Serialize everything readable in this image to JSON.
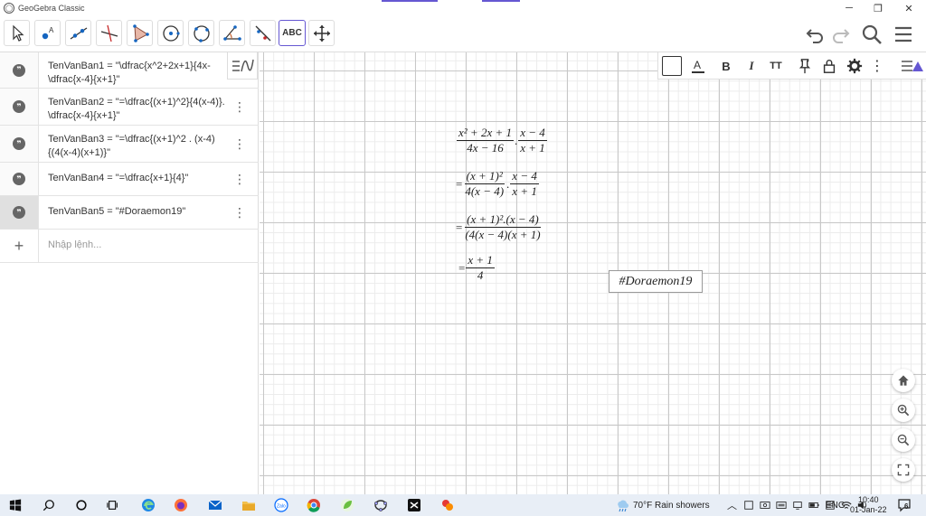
{
  "window": {
    "title": "GeoGebra Classic",
    "minimize": "─",
    "restore": "❐",
    "close": "✕"
  },
  "toolbar": {
    "tools": [
      "move",
      "point",
      "line",
      "perpendicular-line",
      "polygon",
      "circle-center",
      "circle-three-points",
      "angle",
      "reflect",
      "text",
      "move-graphics-view"
    ],
    "text_tool_label": "ABC"
  },
  "algebra": {
    "rows": [
      {
        "line1": "TenVanBan1 = \"\\dfrac{x^2+2x+1}{4x-",
        "line2": "\\dfrac{x-4}{x+1}\""
      },
      {
        "line1": "TenVanBan2 = \"=\\dfrac{(x+1)^2}{4(x-4)}.",
        "line2": "\\dfrac{x-4}{x+1}\""
      },
      {
        "line1": "TenVanBan3 = \"=\\dfrac{(x+1)^2 . (x-4)",
        "line2": "{(4(x-4)(x+1)}\""
      },
      {
        "line1": "TenVanBan4 = \"=\\dfrac{x+1}{4}\"",
        "line2": ""
      },
      {
        "line1": "TenVanBan5 = \"#Doraemon19\"",
        "line2": ""
      }
    ],
    "input_placeholder": "Nhập lệnh..."
  },
  "style_bar": {
    "bold": "B",
    "italic": "I",
    "size": "TT"
  },
  "graphics": {
    "expr1": {
      "num": "x² + 2x + 1",
      "den": "4x − 16",
      "dot": ".",
      "num2": "x − 4",
      "den2": "x + 1"
    },
    "expr2": {
      "eq": "=",
      "num": "(x + 1)²",
      "den": "4(x − 4)",
      "dot": ".",
      "num2": "x − 4",
      "den2": "x + 1"
    },
    "expr3": {
      "eq": "=",
      "num": "(x + 1)².(x − 4)",
      "den": "(4(x − 4)(x + 1)"
    },
    "expr4": {
      "eq": "=",
      "num": "x + 1",
      "den": "4"
    },
    "tag": "#Doraemon19"
  },
  "taskbar": {
    "weather": "70°F  Rain showers",
    "lang": "ENG",
    "time": "10:40",
    "date": "01-Jan-22",
    "notif": "6"
  },
  "colors": {
    "accent": "#6557d2"
  }
}
